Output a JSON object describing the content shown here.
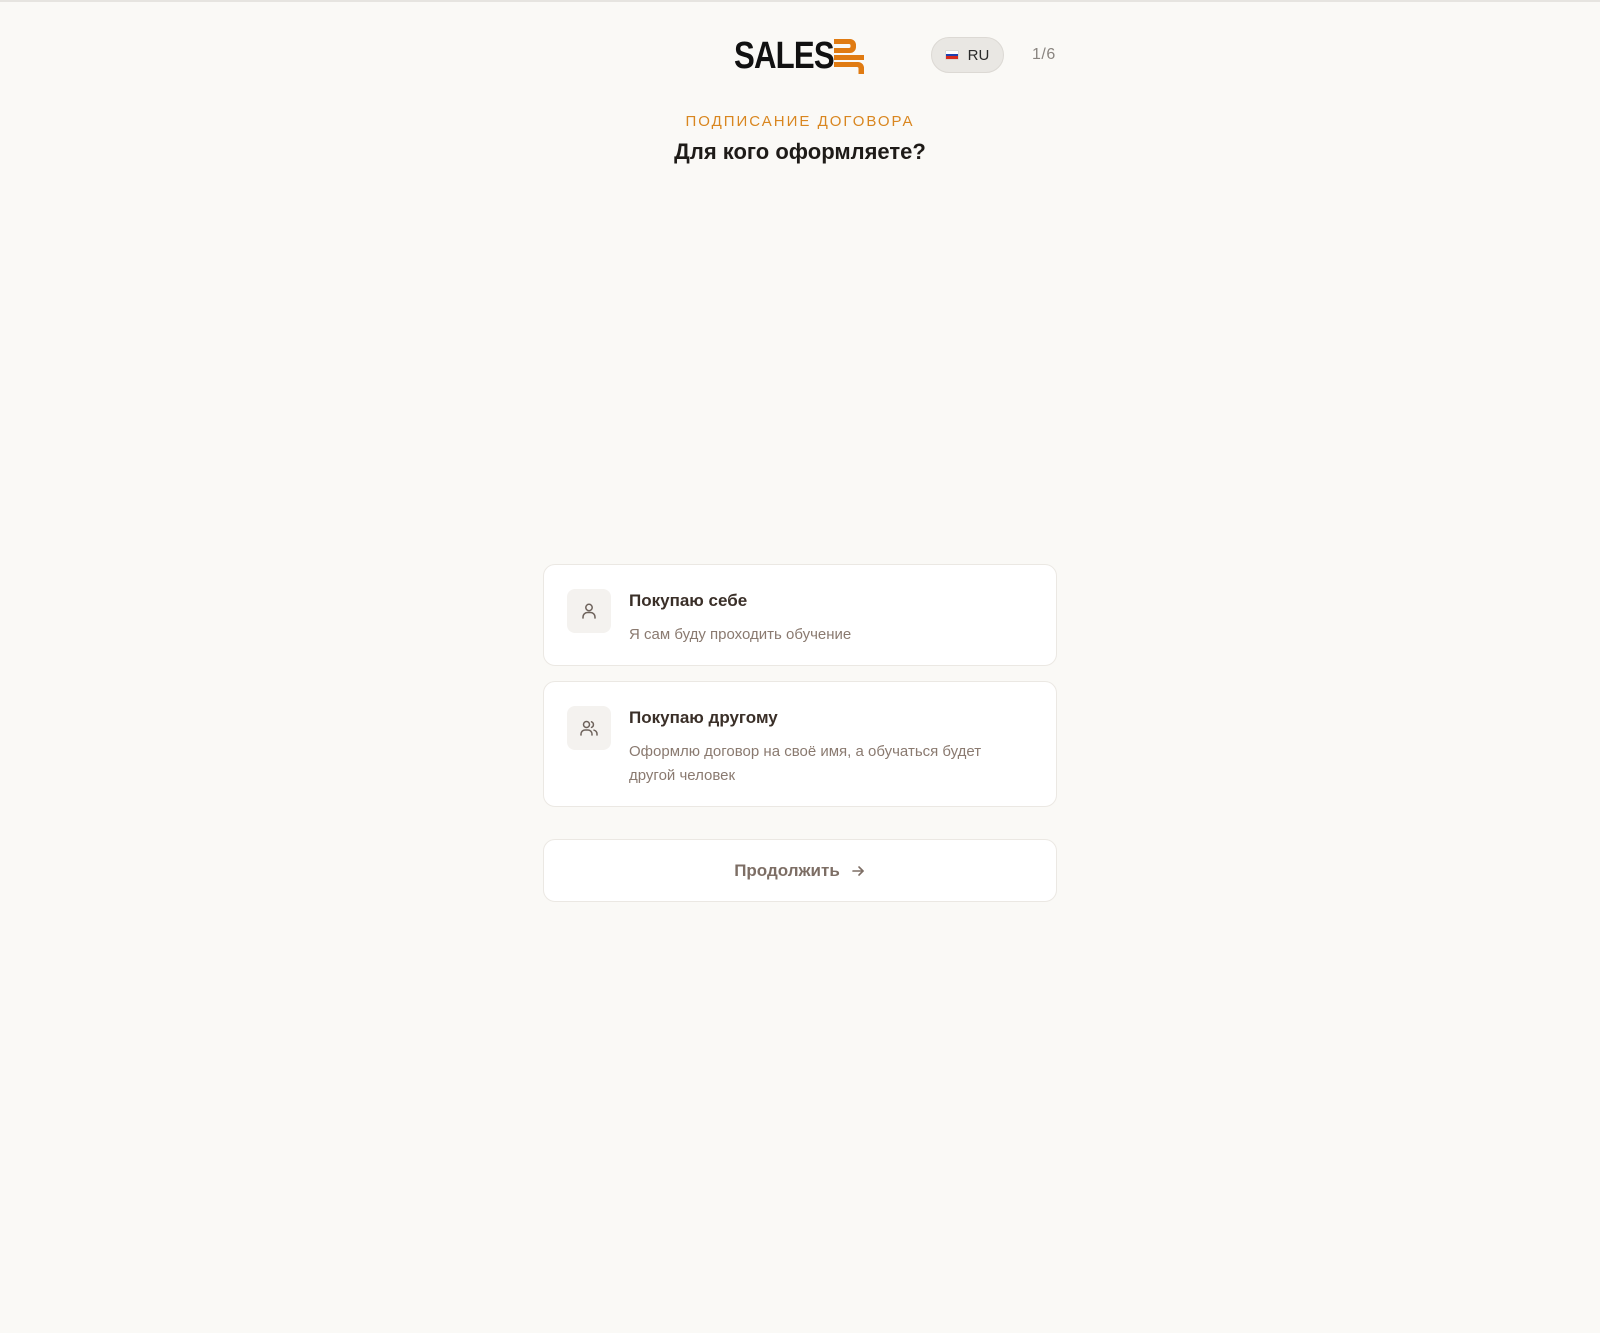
{
  "header": {
    "logo_text": "SALES",
    "logo_mark_text": "UP",
    "language": {
      "code": "RU",
      "flag_icon": "russia-flag-icon"
    },
    "step": "1/6"
  },
  "intro": {
    "overline": "ПОДПИСАНИЕ ДОГОВОРА",
    "title": "Для кого оформляете?"
  },
  "options": [
    {
      "icon": "user-icon",
      "title": "Покупаю себе",
      "description": "Я сам буду проходить обучение"
    },
    {
      "icon": "users-icon",
      "title": "Покупаю другому",
      "description": "Оформлю договор на своё имя, а обучаться будет другой человек"
    }
  ],
  "actions": {
    "continue_label": "Продолжить",
    "continue_icon": "arrow-right-icon"
  },
  "colors": {
    "accent": "#d9861f",
    "background": "#faf9f6",
    "card": "#ffffff"
  }
}
